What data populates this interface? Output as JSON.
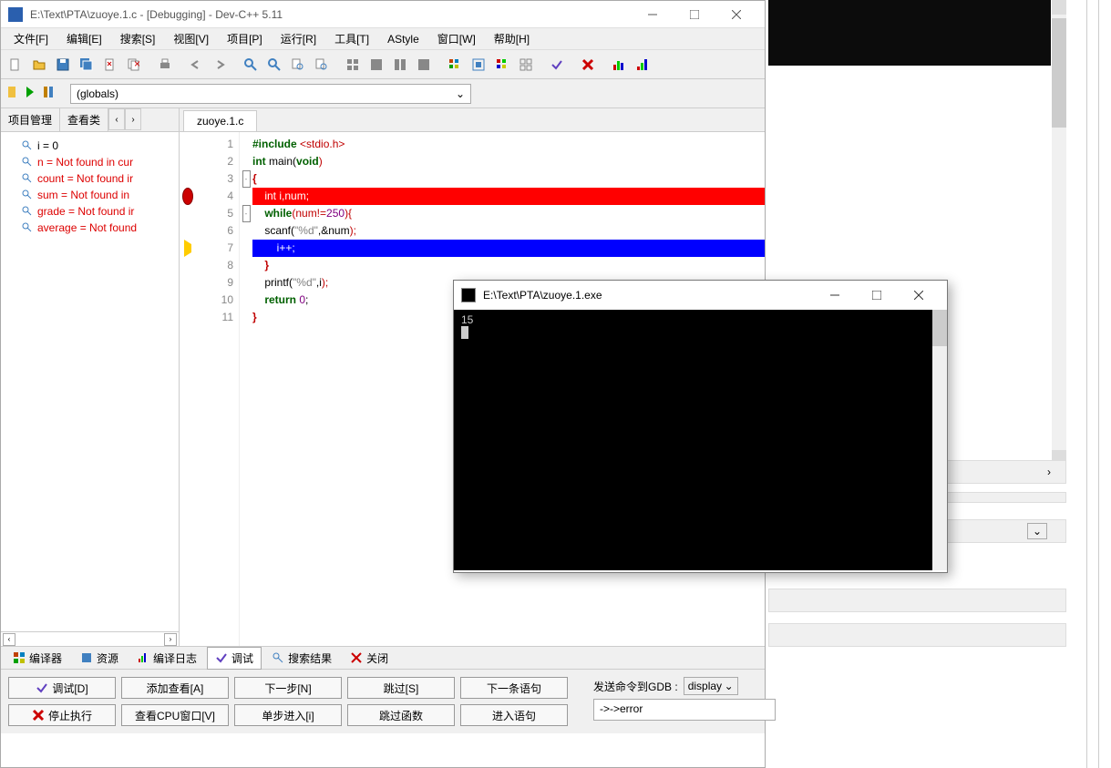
{
  "window": {
    "title": "E:\\Text\\PTA\\zuoye.1.c - [Debugging] - Dev-C++ 5.11"
  },
  "menu": {
    "file": "文件[F]",
    "edit": "编辑[E]",
    "search": "搜索[S]",
    "view": "视图[V]",
    "project": "项目[P]",
    "run": "运行[R]",
    "tools": "工具[T]",
    "astyle": "AStyle",
    "window": "窗口[W]",
    "help": "帮助[H]"
  },
  "globals_combo": "(globals)",
  "side_tabs": {
    "project": "项目管理",
    "classes": "查看类"
  },
  "tree": {
    "i": "i = 0",
    "n": "n = Not found in cur",
    "count": "count = Not found ir",
    "sum": "sum = Not found in",
    "grade": "grade = Not found ir",
    "average": "average = Not found"
  },
  "editor_tab": "zuoye.1.c",
  "code": {
    "l1a": "#include ",
    "l1b": "<stdio.h>",
    "l2a": "int",
    "l2b": " main(",
    "l2c": "void",
    "l2d": ")",
    "l3": "{",
    "l4": "    int i,num;",
    "l5a": "    while",
    "l5b": "(num!=",
    "l5c": "250",
    "l5d": "){",
    "l6a": "    scanf(",
    "l6b": "\"%d\"",
    "l6c": ",&num",
    "l6d": ");",
    "l7": "        i++;",
    "l8": "    }",
    "l9a": "    printf(",
    "l9b": "\"%d\"",
    "l9c": ",i",
    "l9d": ");",
    "l10a": "    return ",
    "l10b": "0",
    "l10c": ";",
    "l11": "}"
  },
  "line_numbers": [
    "1",
    "2",
    "3",
    "4",
    "5",
    "6",
    "7",
    "8",
    "9",
    "10",
    "11"
  ],
  "bottom_tabs": {
    "compiler": "编译器",
    "resource": "资源",
    "log": "编译日志",
    "debug": "调试",
    "search": "搜索结果",
    "close": "关闭"
  },
  "debug_buttons": {
    "debug": "调试[D]",
    "add_watch": "添加查看[A]",
    "next": "下一步[N]",
    "step_over": "跳过[S]",
    "next_stmt": "下一条语句",
    "stop": "停止执行",
    "cpu": "查看CPU窗口[V]",
    "step_into": "单步进入[i]",
    "step_out": "跳过函数",
    "into_stmt": "进入语句"
  },
  "gdb": {
    "label": "发送命令到GDB :",
    "combo": "display",
    "output": "->->error"
  },
  "console": {
    "title": "E:\\Text\\PTA\\zuoye.1.exe",
    "line1": "15"
  }
}
